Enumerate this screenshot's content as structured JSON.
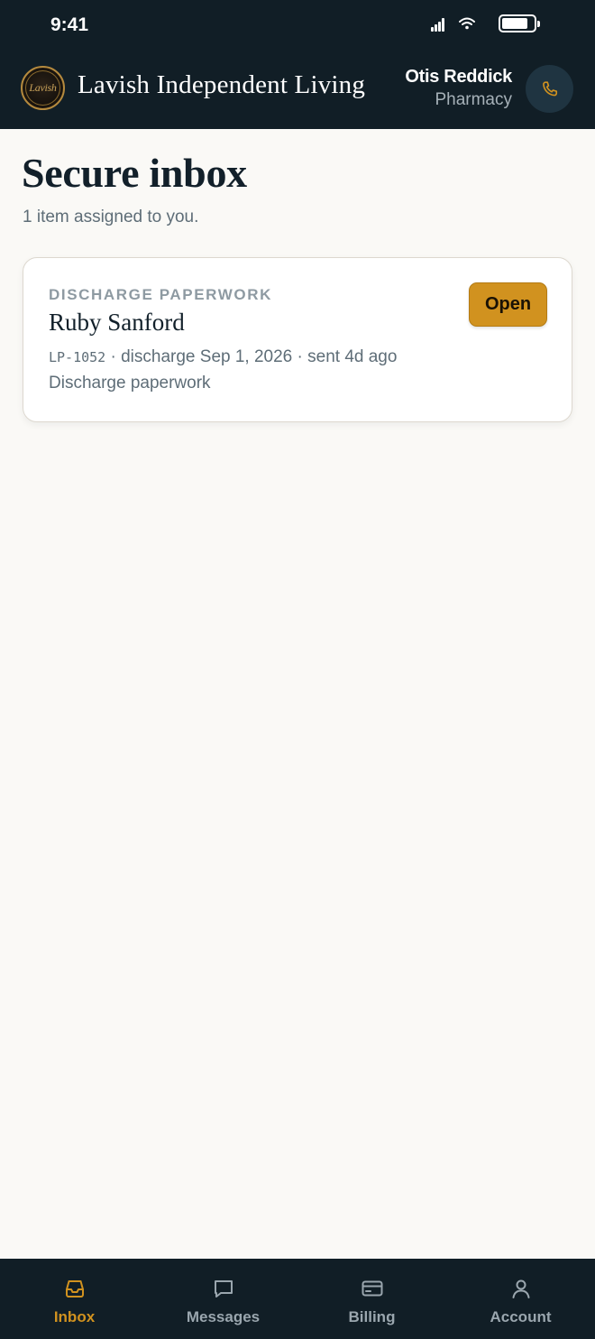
{
  "status_bar": {
    "time": "9:41"
  },
  "header": {
    "logo_text": "Lavish",
    "brand": "Lavish Independent Living",
    "user_name": "Otis Reddick",
    "user_role": "Pharmacy",
    "call_icon": "phone-icon"
  },
  "page": {
    "title": "Secure inbox",
    "subtitle": "1 item assigned to you."
  },
  "inbox": {
    "items": [
      {
        "category": "DISCHARGE PAPERWORK",
        "name": "Ruby Sanford",
        "id": "LP-1052",
        "separator": "·",
        "discharge": "discharge Sep 1, 2026",
        "sent": "sent 4d ago",
        "description": "Discharge paperwork",
        "action_label": "Open"
      }
    ]
  },
  "nav": {
    "items": [
      {
        "label": "Inbox",
        "icon": "inbox-icon",
        "active": true
      },
      {
        "label": "Messages",
        "icon": "message-icon",
        "active": false
      },
      {
        "label": "Billing",
        "icon": "credit-card-icon",
        "active": false
      },
      {
        "label": "Account",
        "icon": "user-icon",
        "active": false
      }
    ]
  },
  "colors": {
    "header_bg": "#111e26",
    "accent": "#d1921f",
    "page_bg": "#faf9f6",
    "muted_text": "#5e6d77"
  }
}
